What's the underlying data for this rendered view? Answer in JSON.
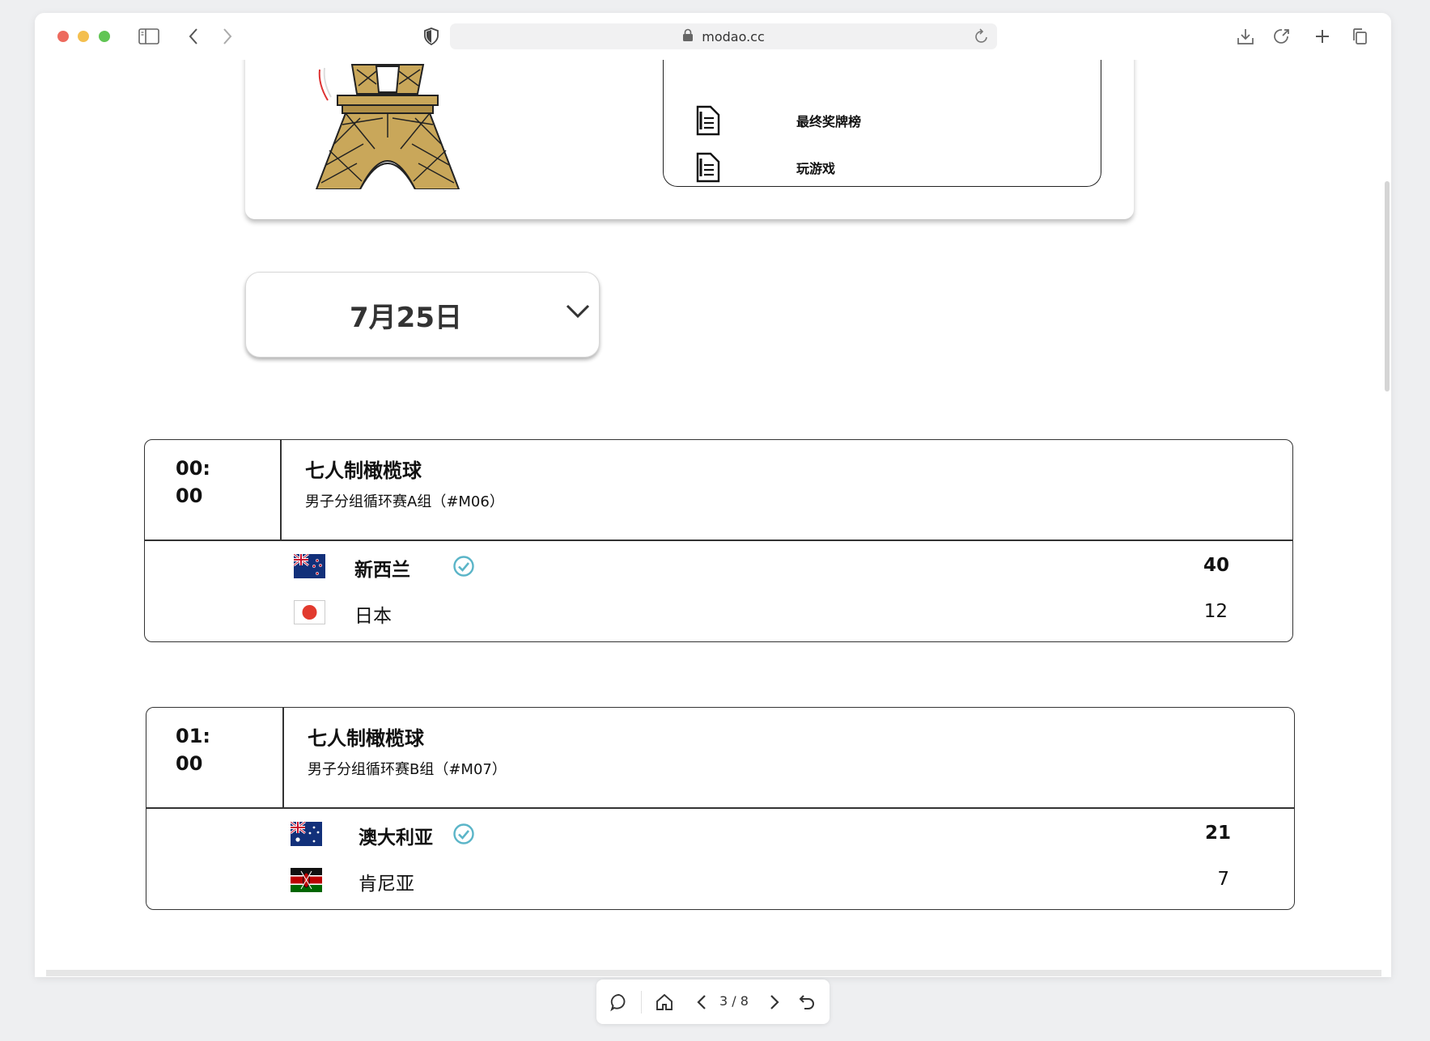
{
  "browser": {
    "url": "modao.cc"
  },
  "menu": {
    "items": [
      {
        "label": "最终奖牌榜"
      },
      {
        "label": "玩游戏"
      }
    ]
  },
  "date_select": {
    "value": "7月25日"
  },
  "matches": [
    {
      "time": [
        "00:",
        "00"
      ],
      "sport": "七人制橄榄球",
      "round": "男子分组循环赛A组（#M06）",
      "teams": [
        {
          "name": "新西兰",
          "score": "40",
          "winner": true,
          "flag": "new-zealand-flag"
        },
        {
          "name": "日本",
          "score": "12",
          "winner": false,
          "flag": "japan-flag"
        }
      ]
    },
    {
      "time": [
        "01:",
        "00"
      ],
      "sport": "七人制橄榄球",
      "round": "男子分组循环赛B组（#M07）",
      "teams": [
        {
          "name": "澳大利亚",
          "score": "21",
          "winner": true,
          "flag": "australia-flag"
        },
        {
          "name": "肯尼亚",
          "score": "7",
          "winner": false,
          "flag": "kenya-flag"
        }
      ]
    }
  ],
  "pager": {
    "indicator": "3 / 8"
  },
  "colors": {
    "check": "#5bb5c8",
    "japan_red": "#e23a2e",
    "nz_blue": "#12307a"
  }
}
